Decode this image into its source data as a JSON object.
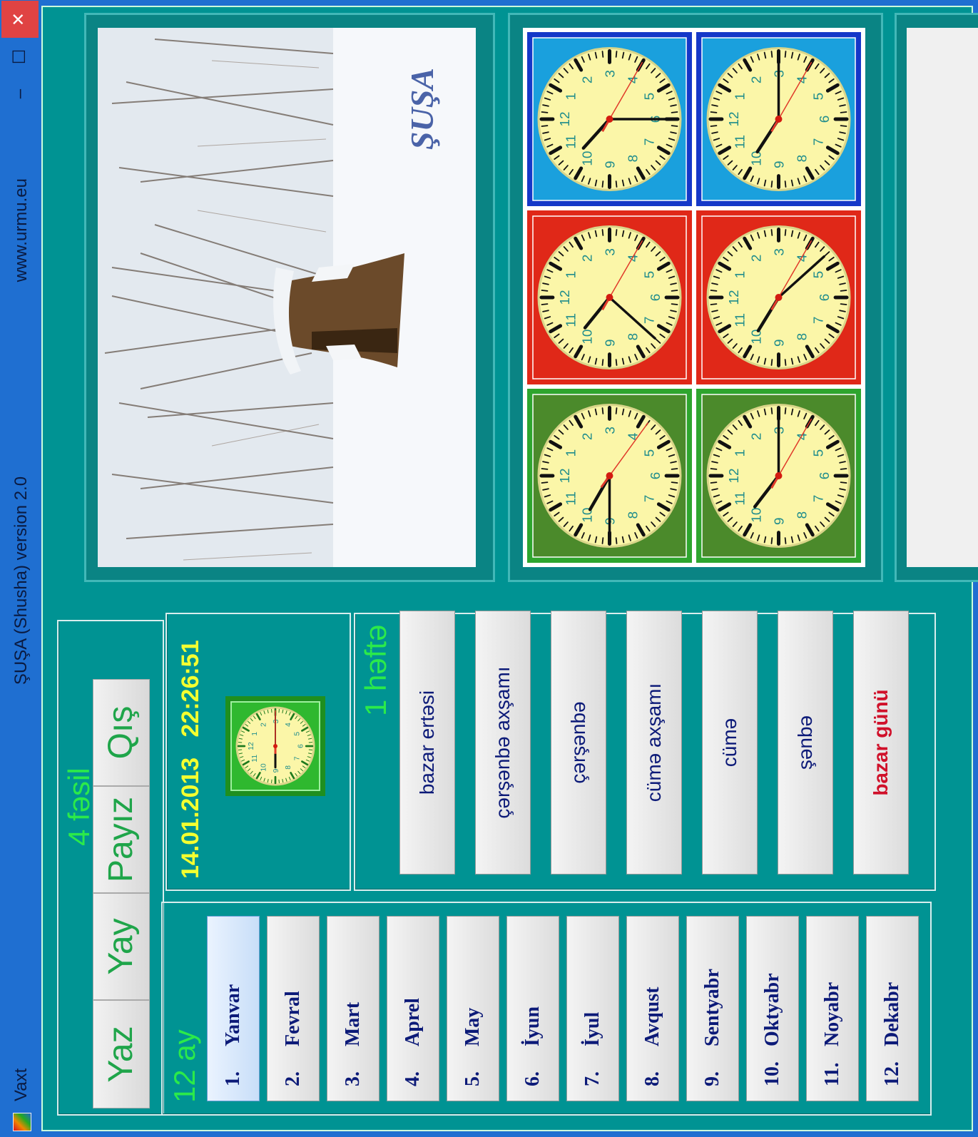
{
  "titlebar": {
    "app_name": "Vaxt",
    "title": "ŞUŞA (Shusha) version 2.0",
    "url": "www.urmu.eu",
    "minimize": "–",
    "maximize": "☐",
    "close": "✕"
  },
  "seasons": {
    "label": "4 fəsil",
    "items": [
      "Yaz",
      "Yay",
      "Payız",
      "Qış"
    ]
  },
  "months": {
    "label": "12 ay",
    "selected": 0,
    "items": [
      {
        "num": "1.",
        "name": "Yanvar"
      },
      {
        "num": "2.",
        "name": "Fevral"
      },
      {
        "num": "3.",
        "name": "Mart"
      },
      {
        "num": "4.",
        "name": "Aprel"
      },
      {
        "num": "5.",
        "name": "May"
      },
      {
        "num": "6.",
        "name": "İyun"
      },
      {
        "num": "7.",
        "name": "İyul"
      },
      {
        "num": "8.",
        "name": "Avqust"
      },
      {
        "num": "9.",
        "name": "Sentyabr"
      },
      {
        "num": "10.",
        "name": "Oktyabr"
      },
      {
        "num": "11.",
        "name": "Noyabr"
      },
      {
        "num": "12.",
        "name": "Dekabr"
      }
    ]
  },
  "clock_info": {
    "date": "14.01.2013",
    "time": "22:26:51"
  },
  "week": {
    "label": "1 həftə",
    "days": [
      "bazar ertəsi",
      "çərşənbə axşamı",
      "çərşənbə",
      "cümə axşamı",
      "cümə",
      "şənbə",
      "bazar günü"
    ]
  },
  "photo": {
    "watermark": "ŞUŞA"
  },
  "clocks": {
    "face_numbers": [
      "12",
      "1",
      "2",
      "3",
      "4",
      "5",
      "6",
      "7",
      "8",
      "9",
      "10",
      "11"
    ],
    "items": [
      {
        "frame_color": "#2ea52e",
        "inner_color": "#4b8a2b",
        "h": 10.0,
        "m": 45,
        "s": 21
      },
      {
        "frame_color": "#2ea52e",
        "inner_color": "#4b8a2b",
        "h": 10.25,
        "m": 15,
        "s": 20
      },
      {
        "frame_color": "#e02818",
        "inner_color": "#e02818",
        "h": 10.3,
        "m": 37,
        "s": 20
      },
      {
        "frame_color": "#e02818",
        "inner_color": "#e02818",
        "h": 10.05,
        "m": 23,
        "s": 20
      },
      {
        "frame_color": "#1538c8",
        "inner_color": "#1aa0dd",
        "h": 10.4,
        "m": 30,
        "s": 20
      },
      {
        "frame_color": "#1538c8",
        "inner_color": "#1aa0dd",
        "h": 10.1,
        "m": 15,
        "s": 20
      }
    ]
  },
  "small_clock": {
    "h": 9.0,
    "m": 15,
    "s": 15
  }
}
